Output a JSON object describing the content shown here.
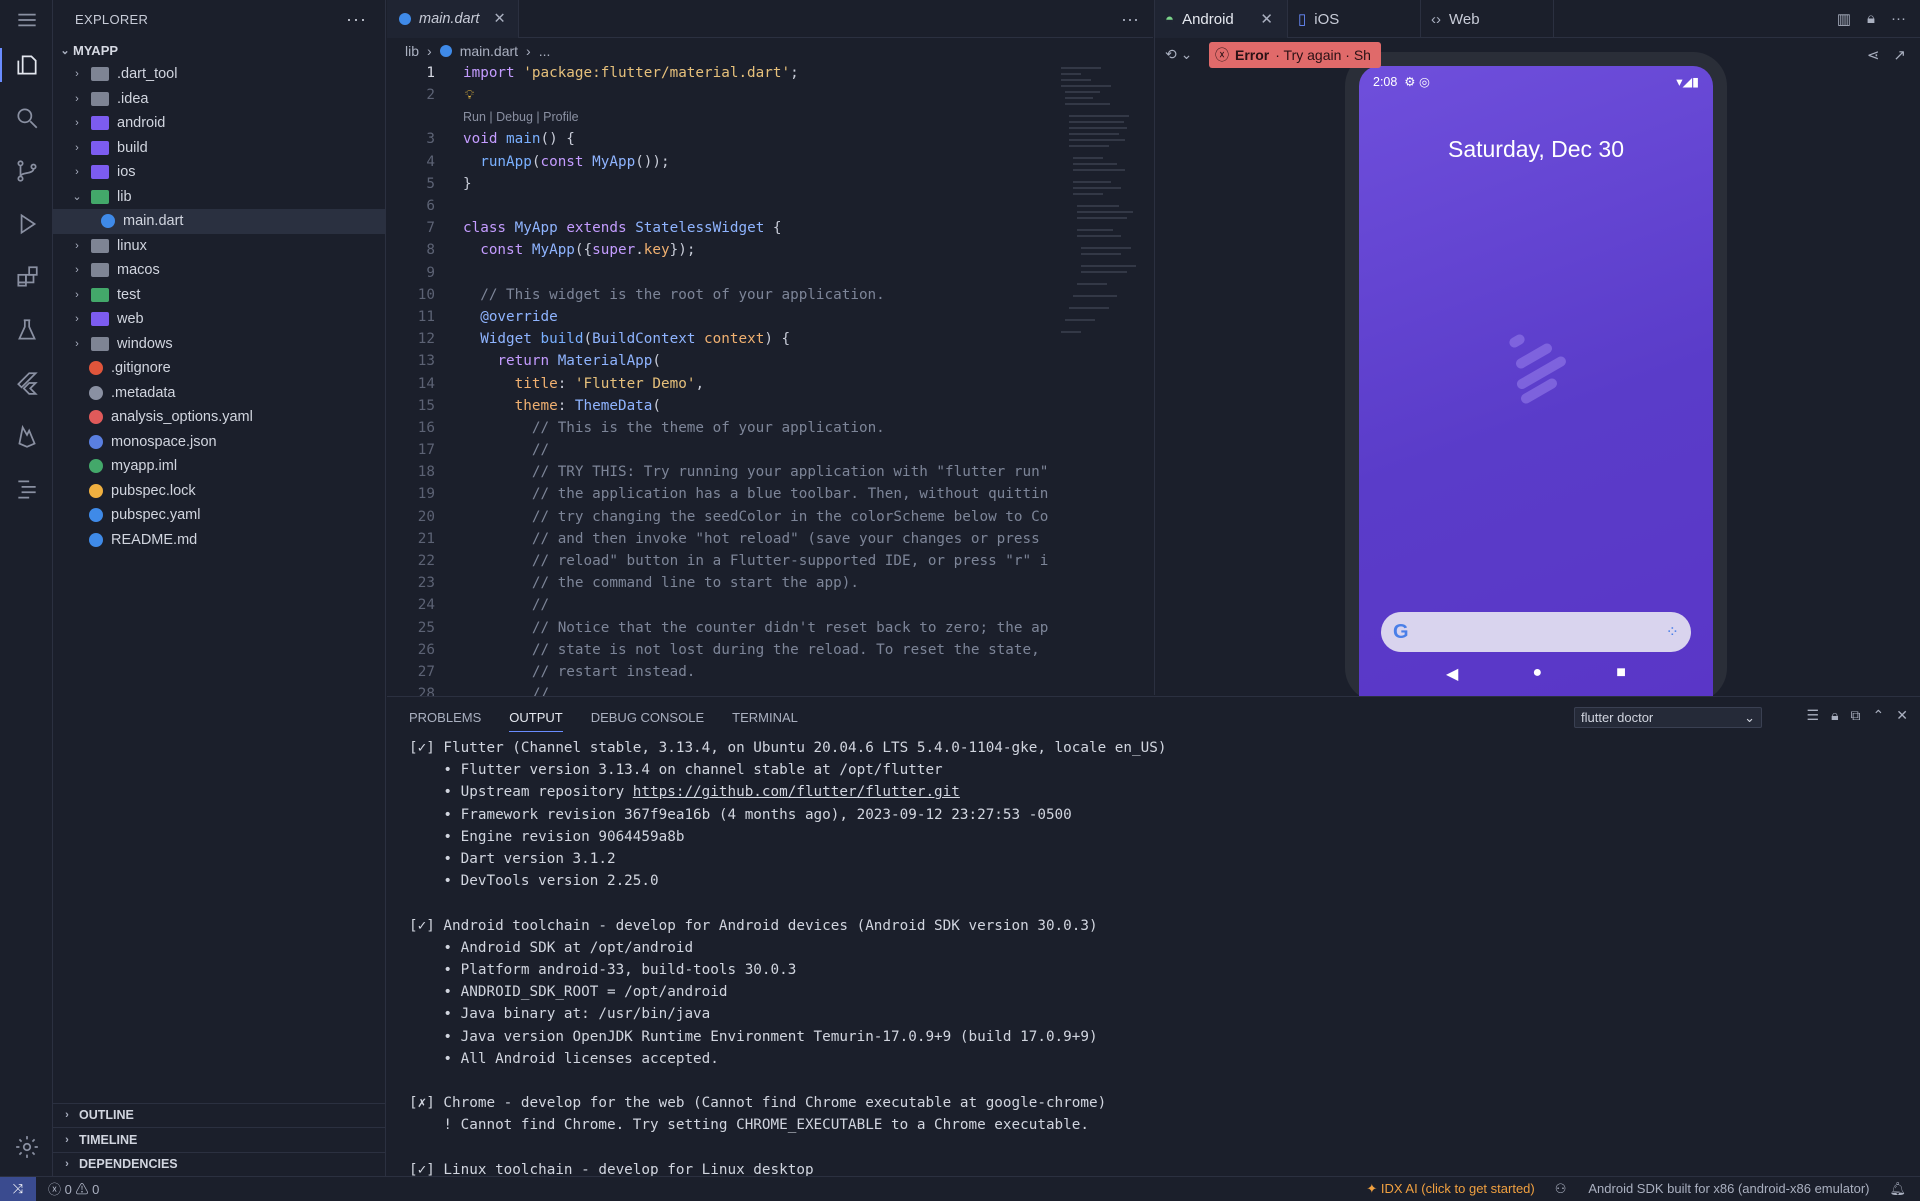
{
  "sidebar": {
    "title": "EXPLORER",
    "root": "MYAPP",
    "items": [
      {
        "label": ".dart_tool",
        "kind": "folder",
        "color": "gray",
        "expanded": false
      },
      {
        "label": ".idea",
        "kind": "folder",
        "color": "gray",
        "expanded": false
      },
      {
        "label": "android",
        "kind": "folder",
        "color": "purple",
        "expanded": false
      },
      {
        "label": "build",
        "kind": "folder",
        "color": "purple",
        "expanded": false
      },
      {
        "label": "ios",
        "kind": "folder",
        "color": "purple",
        "expanded": false
      },
      {
        "label": "lib",
        "kind": "folder",
        "color": "green",
        "expanded": true
      },
      {
        "label": "main.dart",
        "kind": "file",
        "icon": "dart-icon",
        "selected": true
      },
      {
        "label": "linux",
        "kind": "folder",
        "color": "gray",
        "expanded": false
      },
      {
        "label": "macos",
        "kind": "folder",
        "color": "gray",
        "expanded": false
      },
      {
        "label": "test",
        "kind": "folder",
        "color": "green",
        "expanded": false
      },
      {
        "label": "web",
        "kind": "folder",
        "color": "purple",
        "expanded": false
      },
      {
        "label": "windows",
        "kind": "folder",
        "color": "gray",
        "expanded": false
      },
      {
        "label": ".gitignore",
        "kind": "file",
        "icon": "git-icon"
      },
      {
        "label": ".metadata",
        "kind": "file",
        "icon": "file-icon"
      },
      {
        "label": "analysis_options.yaml",
        "kind": "file",
        "icon": "yaml-icon"
      },
      {
        "label": "monospace.json",
        "kind": "file",
        "icon": "json-icon"
      },
      {
        "label": "myapp.iml",
        "kind": "file",
        "icon": "iml-icon"
      },
      {
        "label": "pubspec.lock",
        "kind": "file",
        "icon": "lock-icon"
      },
      {
        "label": "pubspec.yaml",
        "kind": "file",
        "icon": "dart-icon"
      },
      {
        "label": "README.md",
        "kind": "file",
        "icon": "info-icon"
      }
    ],
    "sections": [
      "OUTLINE",
      "TIMELINE",
      "DEPENDENCIES"
    ]
  },
  "editor": {
    "tab": "main.dart",
    "breadcrumb": [
      "lib",
      "main.dart",
      "..."
    ],
    "codelens": "Run | Debug | Profile",
    "lines": [
      {
        "n": "1",
        "html": "<span class=\"kw\">import</span> <span class=\"str\">'package:flutter/material.dart'</span>;"
      },
      {
        "n": "2",
        "html": ""
      },
      {
        "n": "3",
        "html": "<span class=\"kw\">void</span> <span class=\"fn\">main</span>() {"
      },
      {
        "n": "4",
        "html": "  <span class=\"fn\">runApp</span>(<span class=\"kw\">const</span> <span class=\"cls\">MyApp</span>());"
      },
      {
        "n": "5",
        "html": "}"
      },
      {
        "n": "6",
        "html": ""
      },
      {
        "n": "7",
        "html": "<span class=\"kw\">class</span> <span class=\"cls\">MyApp</span> <span class=\"kw\">extends</span> <span class=\"cls\">StatelessWidget</span> {"
      },
      {
        "n": "8",
        "html": "  <span class=\"kw\">const</span> <span class=\"cls\">MyApp</span>({<span class=\"kw\">super</span>.<span class=\"prop\">key</span>});"
      },
      {
        "n": "9",
        "html": ""
      },
      {
        "n": "10",
        "html": "  <span class=\"cm\">// This widget is the root of your application.</span>"
      },
      {
        "n": "11",
        "html": "  <span class=\"cls\">@override</span>"
      },
      {
        "n": "12",
        "html": "  <span class=\"cls\">Widget</span> <span class=\"fn\">build</span>(<span class=\"cls\">BuildContext</span> <span class=\"prop\">context</span>) {"
      },
      {
        "n": "13",
        "html": "    <span class=\"kw\">return</span> <span class=\"cls\">MaterialApp</span>("
      },
      {
        "n": "14",
        "html": "      <span class=\"prop\">title</span>: <span class=\"str\">'Flutter Demo'</span>,"
      },
      {
        "n": "15",
        "html": "      <span class=\"prop\">theme</span>: <span class=\"cls\">ThemeData</span>("
      },
      {
        "n": "16",
        "html": "        <span class=\"cm\">// This is the theme of your application.</span>"
      },
      {
        "n": "17",
        "html": "        <span class=\"cm\">//</span>"
      },
      {
        "n": "18",
        "html": "        <span class=\"cm\">// TRY THIS: Try running your application with \"flutter run\"</span>"
      },
      {
        "n": "19",
        "html": "        <span class=\"cm\">// the application has a blue toolbar. Then, without quittin</span>"
      },
      {
        "n": "20",
        "html": "        <span class=\"cm\">// try changing the seedColor in the colorScheme below to Co</span>"
      },
      {
        "n": "21",
        "html": "        <span class=\"cm\">// and then invoke \"hot reload\" (save your changes or press </span>"
      },
      {
        "n": "22",
        "html": "        <span class=\"cm\">// reload\" button in a Flutter-supported IDE, or press \"r\" i</span>"
      },
      {
        "n": "23",
        "html": "        <span class=\"cm\">// the command line to start the app).</span>"
      },
      {
        "n": "24",
        "html": "        <span class=\"cm\">//</span>"
      },
      {
        "n": "25",
        "html": "        <span class=\"cm\">// Notice that the counter didn't reset back to zero; the ap</span>"
      },
      {
        "n": "26",
        "html": "        <span class=\"cm\">// state is not lost during the reload. To reset the state, </span>"
      },
      {
        "n": "27",
        "html": "        <span class=\"cm\">// restart instead.</span>"
      },
      {
        "n": "28",
        "html": "        <span class=\"cm\">//</span>"
      }
    ]
  },
  "preview": {
    "tabs": [
      {
        "label": "Android",
        "icon": "android-icon",
        "active": true
      },
      {
        "label": "iOS",
        "icon": "phone-icon",
        "active": false
      },
      {
        "label": "Web",
        "icon": "code-icon",
        "active": false
      }
    ],
    "error_label": "Error",
    "error_action": "· Try again · Sh",
    "phone_time": "2:08",
    "phone_date": "Saturday, Dec 30"
  },
  "panel": {
    "tabs": [
      "PROBLEMS",
      "OUTPUT",
      "DEBUG CONSOLE",
      "TERMINAL"
    ],
    "active_tab": "OUTPUT",
    "select_value": "flutter doctor",
    "lines": [
      "[✓] Flutter (Channel stable, 3.13.4, on Ubuntu 20.04.6 LTS 5.4.0-1104-gke, locale en_US)",
      "    • Flutter version 3.13.4 on channel stable at /opt/flutter",
      "    • Upstream repository https://github.com/flutter/flutter.git",
      "    • Framework revision 367f9ea16b (4 months ago), 2023-09-12 23:27:53 -0500",
      "    • Engine revision 9064459a8b",
      "    • Dart version 3.1.2",
      "    • DevTools version 2.25.0",
      "",
      "[✓] Android toolchain - develop for Android devices (Android SDK version 30.0.3)",
      "    • Android SDK at /opt/android",
      "    • Platform android-33, build-tools 30.0.3",
      "    • ANDROID_SDK_ROOT = /opt/android",
      "    • Java binary at: /usr/bin/java",
      "    • Java version OpenJDK Runtime Environment Temurin-17.0.9+9 (build 17.0.9+9)",
      "    • All Android licenses accepted.",
      "",
      "[✗] Chrome - develop for the web (Cannot find Chrome executable at google-chrome)",
      "    ! Cannot find Chrome. Try setting CHROME_EXECUTABLE to a Chrome executable.",
      "",
      "[✓] Linux toolchain - develop for Linux desktop"
    ]
  },
  "statusbar": {
    "errors": "0",
    "warnings": "0",
    "ai": "IDX AI (click to get started)",
    "device": "Android SDK built for x86 (android-x86 emulator)"
  }
}
